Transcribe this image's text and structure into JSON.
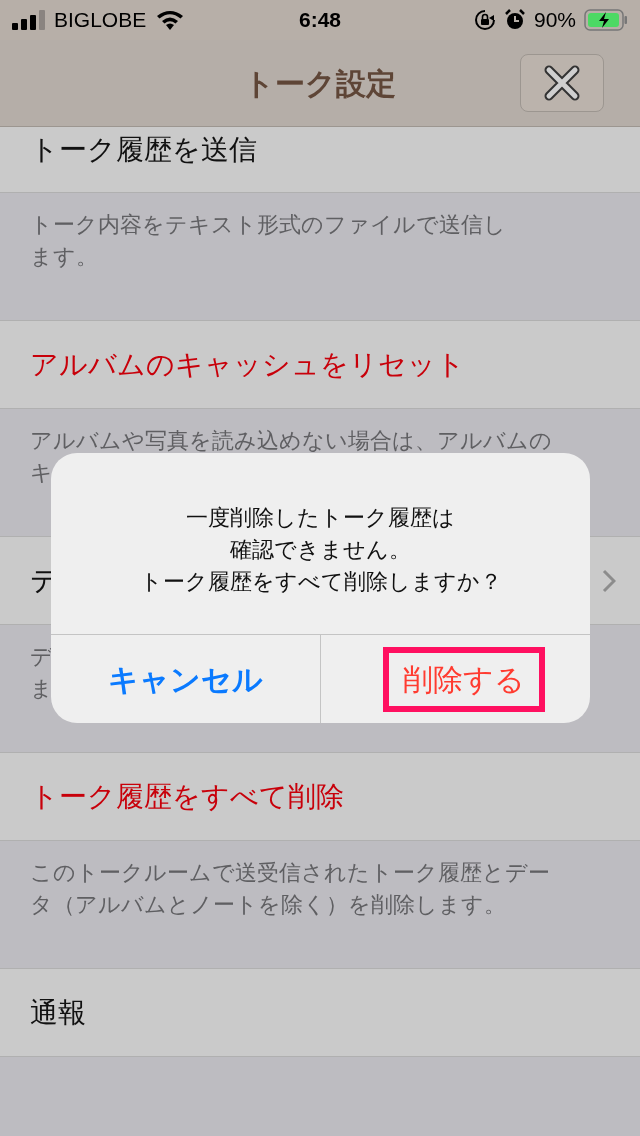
{
  "status_bar": {
    "carrier": "BIGLOBE",
    "time": "6:48",
    "battery": "90%"
  },
  "nav": {
    "title": "トーク設定"
  },
  "sections": [
    {
      "title": "トーク履歴を送信",
      "kind": "plain",
      "destructive": false,
      "chevron": false,
      "description": [
        "トーク内容をテキスト形式のファイルで送信し",
        "ます。"
      ]
    },
    {
      "title": "アルバムのキャッシュをリセット",
      "kind": "plain",
      "destructive": true,
      "chevron": false,
      "description": [
        "アルバムや写真を読み込めない場合は、アルバムの",
        "キ"
      ]
    },
    {
      "title": "テ",
      "kind": "plain",
      "destructive": false,
      "chevron": true,
      "description": [
        "デ",
        "ま"
      ]
    },
    {
      "title": "トーク履歴をすべて削除",
      "kind": "plain",
      "destructive": true,
      "chevron": false,
      "description": [
        "このトークルームで送受信されたトーク履歴とデー",
        "タ（アルバムとノートを除く）を削除します。"
      ]
    },
    {
      "title": "通報",
      "kind": "plain",
      "destructive": false,
      "chevron": false
    }
  ],
  "dialog": {
    "message": [
      "一度削除したトーク履歴は",
      "確認できません。",
      "トーク履歴をすべて削除しますか？"
    ],
    "buttons": [
      {
        "label": "キャンセル",
        "highlighted": false
      },
      {
        "label": "削除する",
        "highlighted": true
      }
    ]
  }
}
